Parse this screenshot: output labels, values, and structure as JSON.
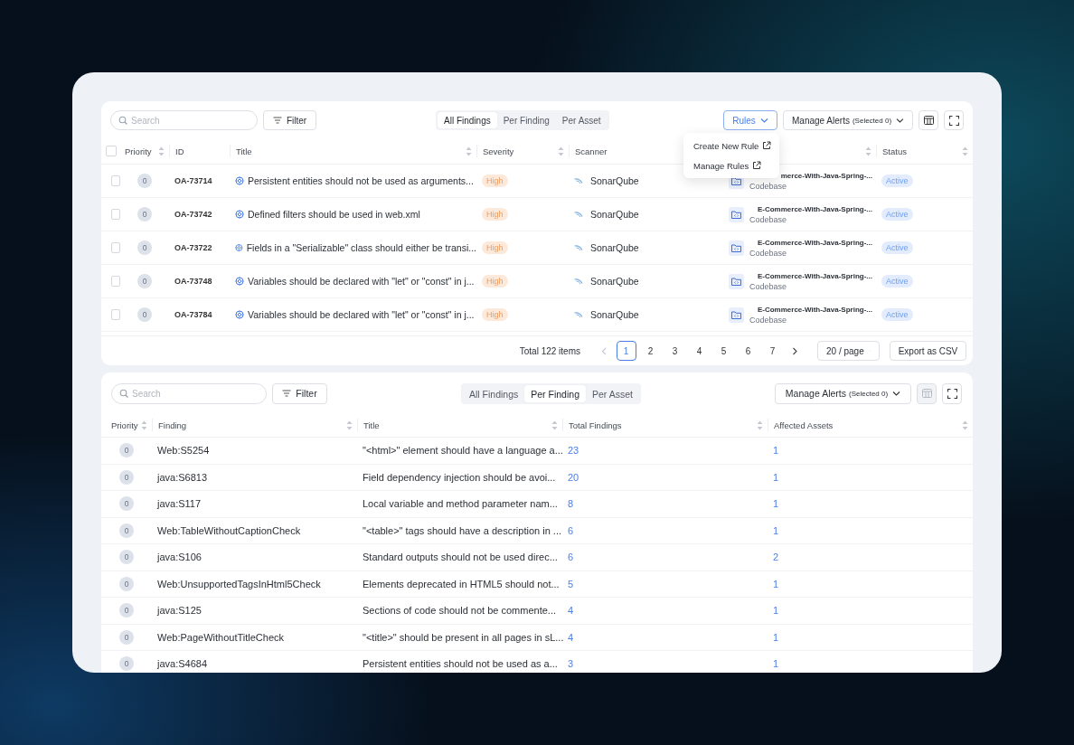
{
  "findings_panel": {
    "search": {
      "placeholder": "Search"
    },
    "filter_button": "Filter",
    "view_tabs": [
      {
        "label": "All Findings",
        "selected": true
      },
      {
        "label": "Per Finding",
        "selected": false
      },
      {
        "label": "Per Asset",
        "selected": false
      }
    ],
    "rules_button": "Rules",
    "manage_alerts": {
      "label": "Manage Alerts",
      "count": "(Selected 0)"
    },
    "columns_button": {
      "disabled": false
    },
    "rules_menu": [
      "Create New Rule",
      "Manage Rules"
    ],
    "table": {
      "select_all": {
        "checked": false
      },
      "columns": [
        {
          "label": "Priority",
          "sortable": true
        },
        {
          "label": "ID",
          "sortable": false
        },
        {
          "label": "Title",
          "sortable": true
        },
        {
          "label": "Severity",
          "sortable": true
        },
        {
          "label": "Scanner",
          "sortable": false
        },
        {
          "sortable": true
        },
        {
          "label": "Status",
          "sortable": true
        }
      ],
      "rows": [
        {
          "checked": false,
          "priority": "0",
          "id": "OA-73714",
          "title": "Persistent entities should not be used as arguments...",
          "severity": "High",
          "scanner": "SonarQube",
          "asset": "merce-With-Java-Spring-...",
          "asset_type": "Codebase",
          "status": "Active"
        },
        {
          "checked": false,
          "priority": "0",
          "id": "OA-73742",
          "title": "Defined filters should be used in web.xml",
          "severity": "High",
          "scanner": "SonarQube",
          "asset": "E-Commerce-With-Java-Spring-...",
          "asset_type": "Codebase",
          "status": "Active"
        },
        {
          "checked": false,
          "priority": "0",
          "id": "OA-73722",
          "title": "Fields in a \"Serializable\" class should either be transi...",
          "severity": "High",
          "scanner": "SonarQube",
          "asset": "E-Commerce-With-Java-Spring-...",
          "asset_type": "Codebase",
          "status": "Active"
        },
        {
          "checked": false,
          "priority": "0",
          "id": "OA-73748",
          "title": "Variables should be declared with \"let\" or \"const\" in j...",
          "severity": "High",
          "scanner": "SonarQube",
          "asset": "E-Commerce-With-Java-Spring-...",
          "asset_type": "Codebase",
          "status": "Active"
        },
        {
          "checked": false,
          "priority": "0",
          "id": "OA-73784",
          "title": "Variables should be declared with \"let\" or \"const\" in j...",
          "severity": "High",
          "scanner": "SonarQube",
          "asset": "E-Commerce-With-Java-Spring-...",
          "asset_type": "Codebase",
          "status": "Active"
        }
      ]
    },
    "pagination": {
      "total": "Total 122 items",
      "pages": [
        {
          "label": "1",
          "selected": true
        },
        {
          "label": "2",
          "selected": false
        },
        {
          "label": "3",
          "selected": false
        },
        {
          "label": "4",
          "selected": false
        },
        {
          "label": "5",
          "selected": false
        },
        {
          "label": "6",
          "selected": false
        },
        {
          "label": "7",
          "selected": false
        }
      ],
      "page_size": "20 / page",
      "export_button": "Export as CSV"
    }
  },
  "per_finding_panel": {
    "search": {
      "placeholder": "Search"
    },
    "filter_button": "Filter",
    "view_tabs": [
      {
        "label": "All Findings",
        "selected": false
      },
      {
        "label": "Per Finding",
        "selected": true
      },
      {
        "label": "Per Asset",
        "selected": false
      }
    ],
    "manage_alerts": {
      "label": "Manage Alerts",
      "count": "(Selected 0)"
    },
    "columns_button": {
      "disabled": true
    },
    "table": {
      "columns": [
        {
          "label": "Priority",
          "sortable": true
        },
        {
          "label": "Finding",
          "sortable": true
        },
        {
          "label": "Title",
          "sortable": true
        },
        {
          "label": "Total Findings",
          "sortable": true
        },
        {
          "label": "Affected Assets",
          "sortable": true
        }
      ],
      "rows": [
        {
          "priority": "0",
          "finding": "Web:S5254",
          "title": "\"<html>\" element should have a language a...",
          "total_findings": "23",
          "affected_assets": "1"
        },
        {
          "priority": "0",
          "finding": "java:S6813",
          "title": "Field dependency injection should be avoi...",
          "total_findings": "20",
          "affected_assets": "1"
        },
        {
          "priority": "0",
          "finding": "java:S117",
          "title": "Local variable and method parameter nam...",
          "total_findings": "8",
          "affected_assets": "1"
        },
        {
          "priority": "0",
          "finding": "Web:TableWithoutCaptionCheck",
          "title": "\"<table>\" tags should have a description in ...",
          "total_findings": "6",
          "affected_assets": "1"
        },
        {
          "priority": "0",
          "finding": "java:S106",
          "title": "Standard outputs should not be used direc...",
          "total_findings": "6",
          "affected_assets": "2"
        },
        {
          "priority": "0",
          "finding": "Web:UnsupportedTagsInHtml5Check",
          "title": "Elements deprecated in HTML5 should not...",
          "total_findings": "5",
          "affected_assets": "1"
        },
        {
          "priority": "0",
          "finding": "java:S125",
          "title": "Sections of code should not be commente...",
          "total_findings": "4",
          "affected_assets": "1"
        },
        {
          "priority": "0",
          "finding": "Web:PageWithoutTitleCheck",
          "title": "\"<title>\" should be present in all pages in sL...",
          "total_findings": "4",
          "affected_assets": "1"
        },
        {
          "priority": "0",
          "finding": "java:S4684",
          "title": "Persistent entities should not be used as a...",
          "total_findings": "3",
          "affected_assets": "1"
        }
      ]
    }
  }
}
